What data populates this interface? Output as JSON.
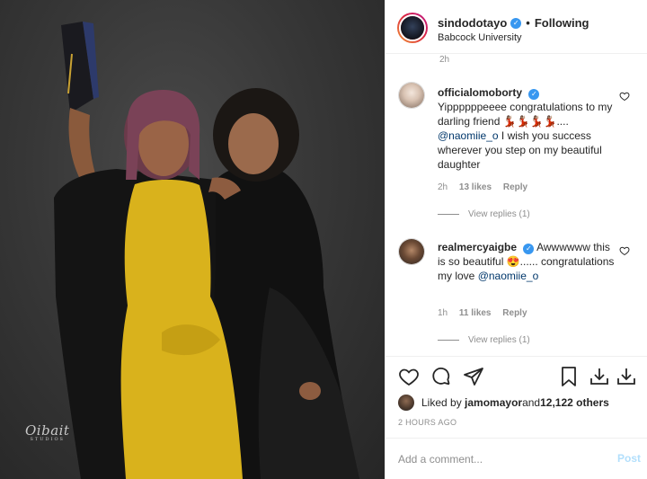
{
  "post": {
    "username": "sindodotayo",
    "follow_status": "Following",
    "separator": "•",
    "location": "Babcock University",
    "verified_glyph": "✓",
    "photo_watermark": "Oibait",
    "photo_watermark_sub": "STUDIOS"
  },
  "comments": {
    "previous_time": "2h",
    "items": [
      {
        "username": "officialomoborty",
        "text_before": "Yippppppeeee congratulations to my darling friend 💃🏽💃🏽💃🏽💃🏽.... ",
        "mention": "@naomiie_o",
        "text_after": " I wish you success wherever you step on my beautiful daughter",
        "time": "2h",
        "likes": "13 likes",
        "reply": "Reply",
        "view_replies": "View replies (1)"
      },
      {
        "username": "realmercyaigbe",
        "text_before": " Awwwwww this is so beautiful 😍...... congratulations my love ",
        "mention": "@naomiie_o",
        "text_after": "",
        "time": "1h",
        "likes": "11 likes",
        "reply": "Reply",
        "view_replies": "View replies (1)"
      }
    ]
  },
  "likes": {
    "prefix": "Liked by ",
    "liker": "jamomayor",
    "middle": " and ",
    "others": "12,122 others"
  },
  "timestamp": "2 HOURS AGO",
  "add_comment": {
    "placeholder": "Add a comment...",
    "post_label": "Post"
  },
  "colors": {
    "verified": "#3897f0",
    "mention": "#00376b",
    "muted": "#8e8e8e",
    "post_disabled": "#b2dffc",
    "dress_yellow": "#d9b21c"
  },
  "icons": [
    "heart-icon",
    "comment-icon",
    "share-icon",
    "bookmark-icon",
    "download-icon"
  ]
}
